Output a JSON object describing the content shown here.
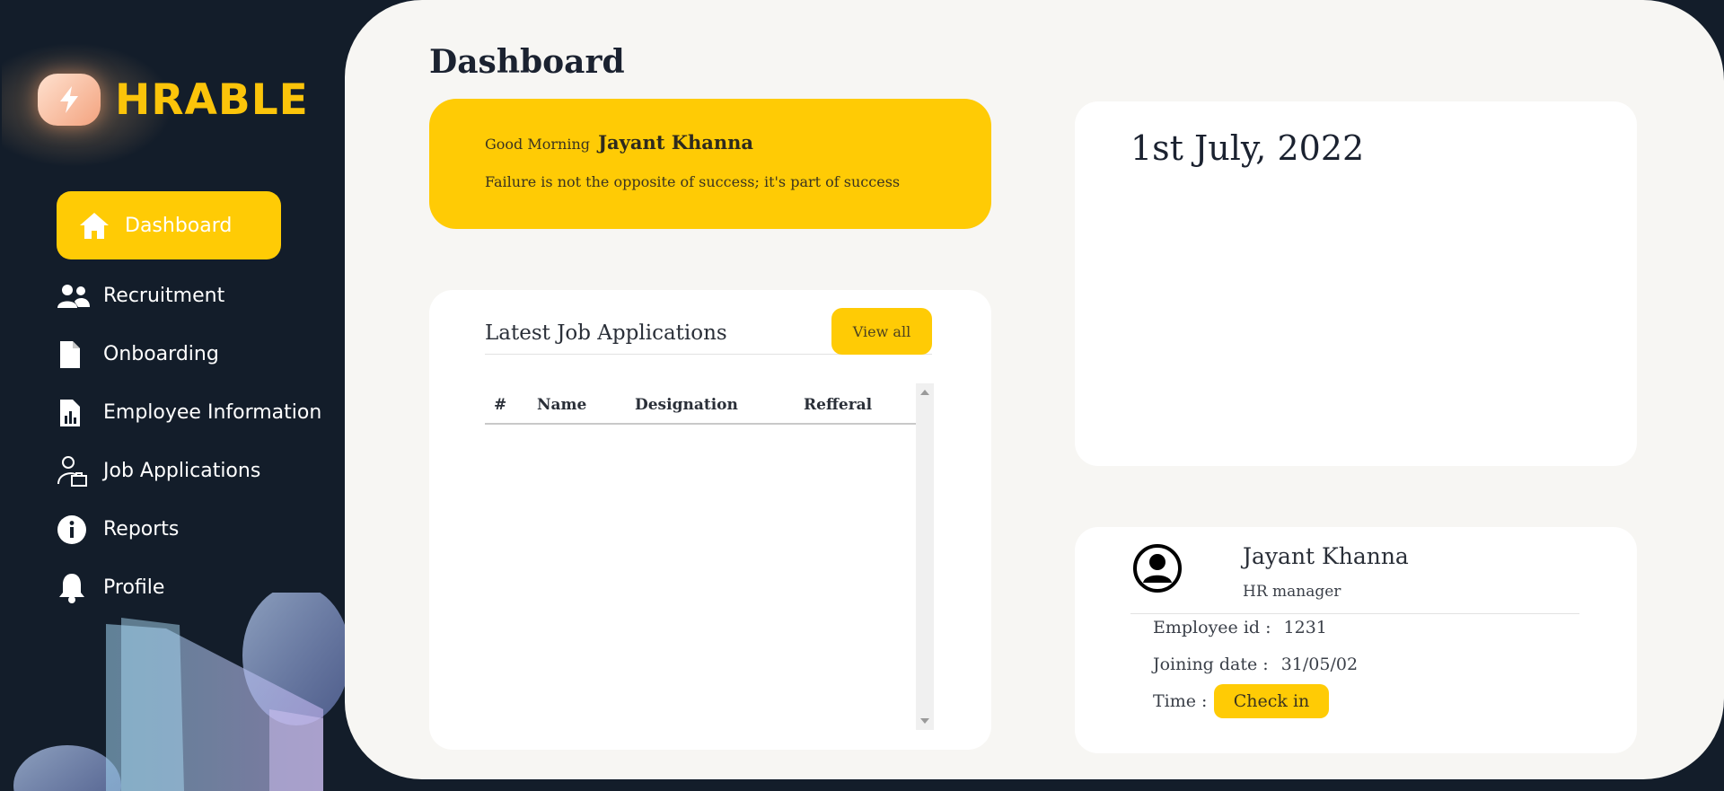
{
  "brand": {
    "name": "HRABLE",
    "logo_icon": "bolt-icon"
  },
  "sidebar": {
    "items": [
      {
        "label": "Dashboard",
        "icon": "home-icon",
        "active": true
      },
      {
        "label": "Recruitment",
        "icon": "users-icon"
      },
      {
        "label": "Onboarding",
        "icon": "document-icon"
      },
      {
        "label": "Employee Information",
        "icon": "report-chart-icon"
      },
      {
        "label": "Job Applications",
        "icon": "person-briefcase-icon"
      },
      {
        "label": "Reports",
        "icon": "info-icon"
      },
      {
        "label": "Profile",
        "icon": "bell-icon"
      }
    ]
  },
  "main": {
    "title": "Dashboard",
    "greeting": {
      "prefix": "Good Morning",
      "name": "Jayant Khanna",
      "quote": "Failure is not the opposite of success; it's part of success"
    },
    "jobs": {
      "title": "Latest Job Applications",
      "view_all": "View all",
      "columns": [
        "#",
        "Name",
        "Designation",
        "Refferal"
      ],
      "rows": []
    },
    "date": "1st July, 2022",
    "profile": {
      "name": "Jayant Khanna",
      "role": "HR manager",
      "employee_id_label": "Employee id :",
      "employee_id": "1231",
      "joining_label": "Joining date :",
      "joining_date": "31/05/02",
      "time_label": "Time :",
      "checkin_label": "Check in"
    }
  },
  "colors": {
    "accent": "#ffcb05",
    "sidebar_bg": "#131d2a",
    "main_bg": "#f7f6f3",
    "brand": "#fbc40a"
  }
}
